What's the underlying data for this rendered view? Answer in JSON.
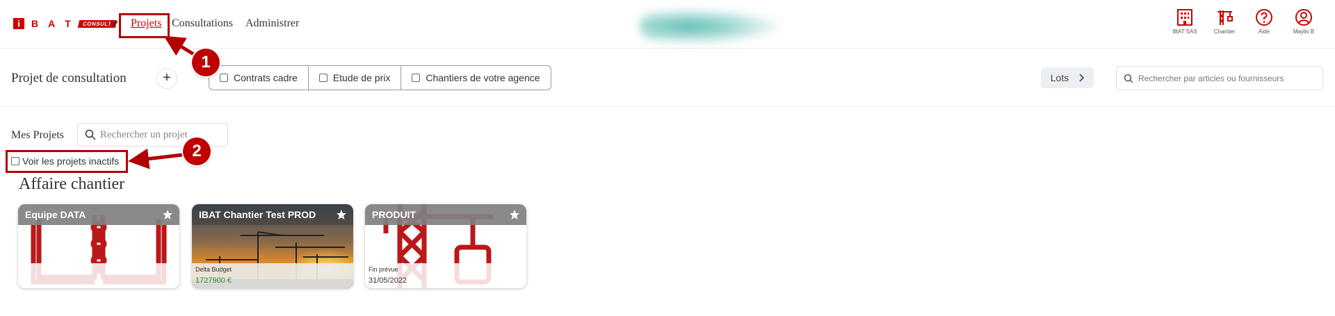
{
  "logo": {
    "mark": "i",
    "letters": [
      "B",
      "A",
      "T"
    ],
    "consult": "CONSULT"
  },
  "nav": {
    "projets": "Projets",
    "consultations": "Consultations",
    "administrer": "Administrer"
  },
  "right_icons": [
    {
      "icon": "building-icon",
      "label": "IBAT SAS"
    },
    {
      "icon": "crane-icon",
      "label": "Chantier"
    },
    {
      "icon": "help-icon",
      "label": "Aide"
    },
    {
      "icon": "user-icon",
      "label": "Maylis B"
    }
  ],
  "toolbar": {
    "title": "Projet de consultation",
    "add_label": "+",
    "filters": [
      "Contrats cadre",
      "Etude de prix",
      "Chantiers de votre agence"
    ],
    "lots_label": "Lots",
    "search_placeholder": "Rechercher par articles ou fournisseurs"
  },
  "projects": {
    "label": "Mes Projets",
    "search_placeholder": "Rechercher un projet",
    "inactive_label": "Voir les projets inactifs",
    "section_title": "Affaire chantier",
    "cards": [
      {
        "title": "Equipe DATA",
        "image": "binder-icon",
        "foot_key": "",
        "foot_value": ""
      },
      {
        "title": "IBAT Chantier Test PROD",
        "image": "construction-sunset-photo",
        "foot_key": "Delta Budget",
        "foot_value": "1727900 €"
      },
      {
        "title": "PRODUIT",
        "image": "crane-icon",
        "foot_key": "Fin prévue",
        "foot_value": "31/05/2022"
      }
    ]
  },
  "annotations": [
    "1",
    "2"
  ],
  "colors": {
    "brand": "#cc0000",
    "annotation": "#b30000",
    "budget_green": "#2e8b2e"
  }
}
